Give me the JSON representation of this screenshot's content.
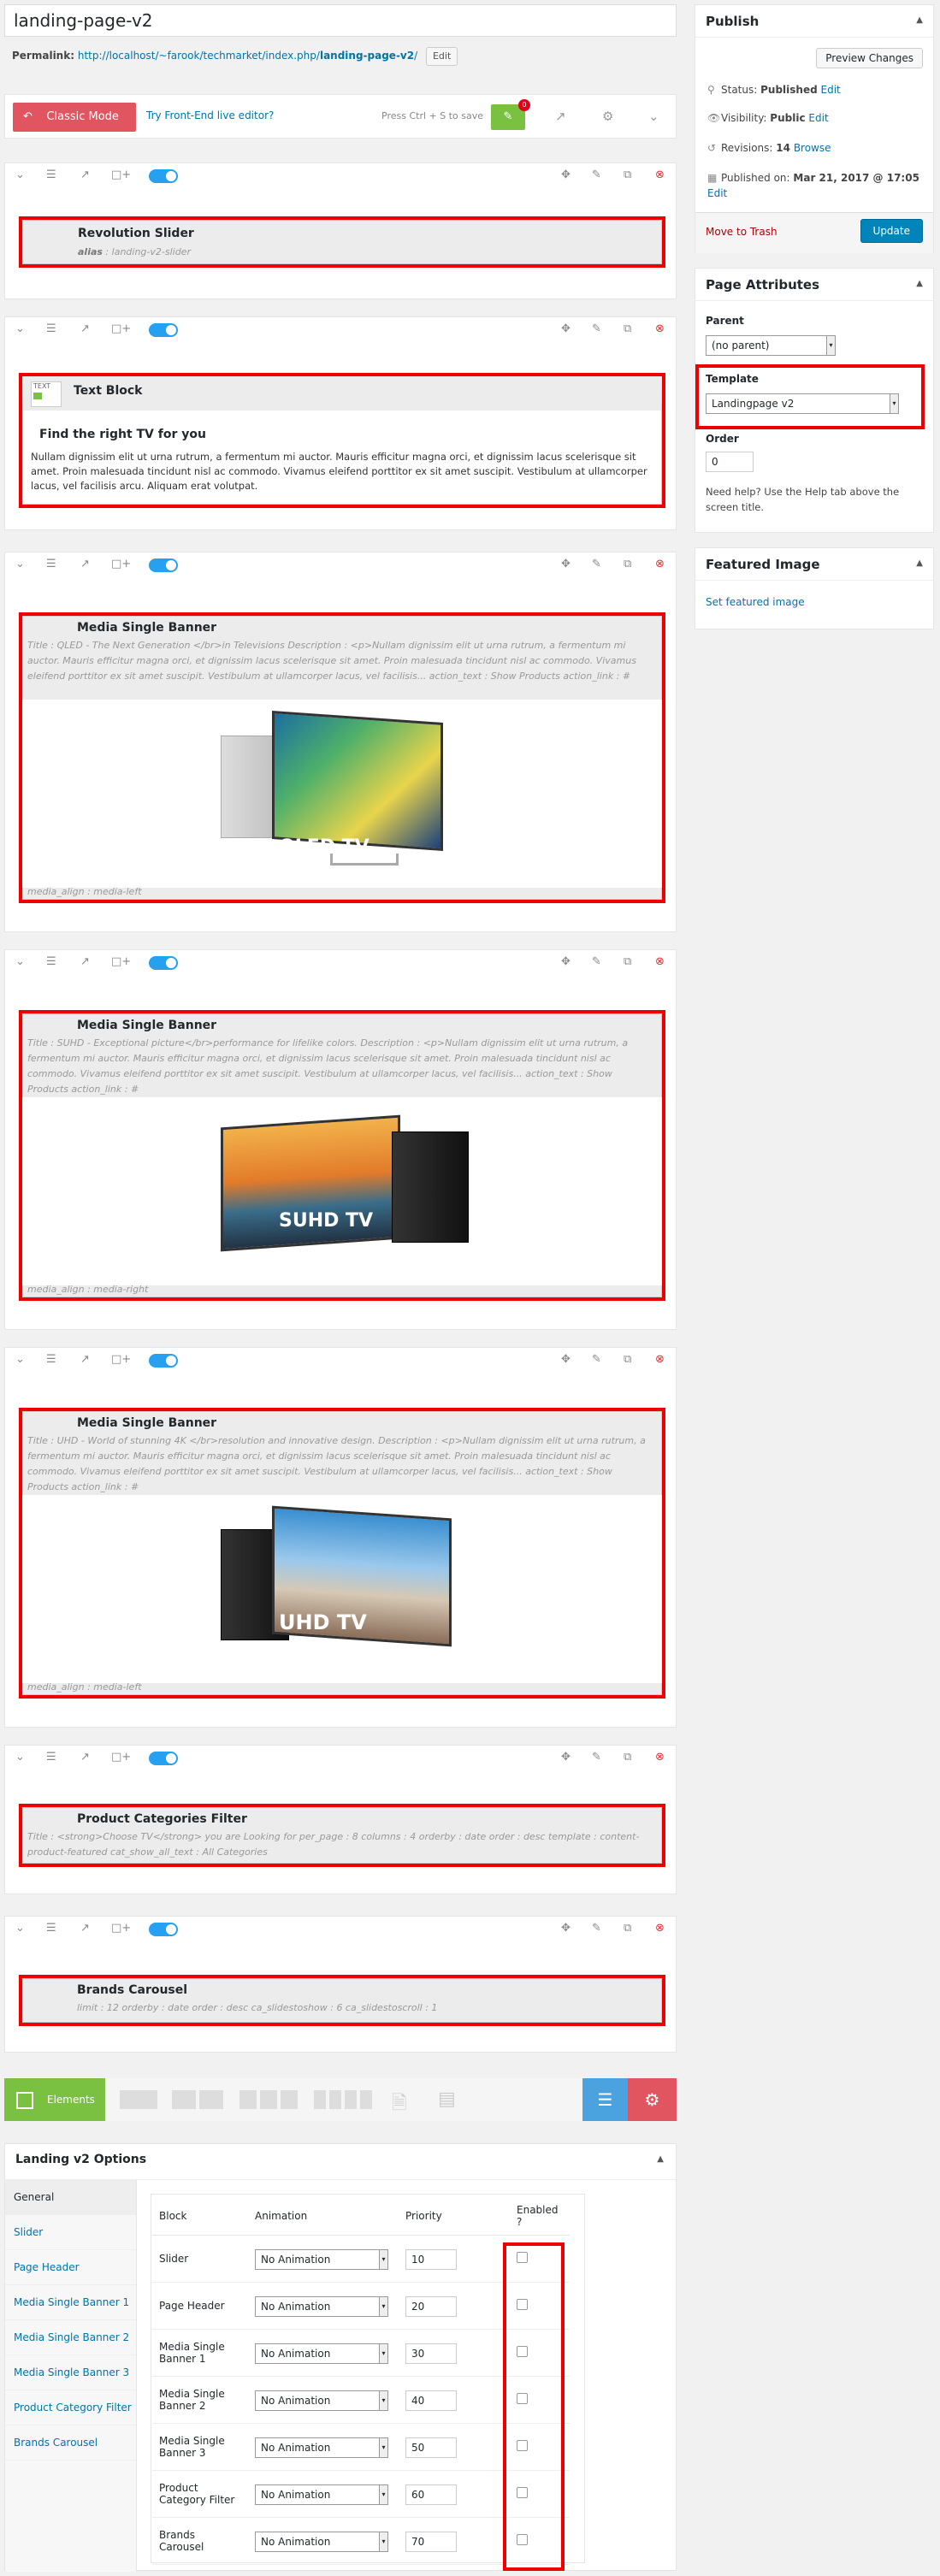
{
  "page_title": "landing-page-v2",
  "permalink": {
    "label": "Permalink:",
    "url_prefix": "http://localhost/~farook/techmarket/index.php/",
    "slug": "landing-page-v2",
    "url_suffix": "/",
    "edit": "Edit"
  },
  "vc_toolbar": {
    "classic_mode": "Classic Mode",
    "frontend_link": "Try Front-End live editor?",
    "save_hint": "Press Ctrl + S to save",
    "badge": "0"
  },
  "rows": [
    {
      "title": "Revolution Slider",
      "params": [
        {
          "k": "alias",
          "v": "landing-v2-slider"
        }
      ]
    },
    {
      "title": "Text Block",
      "heading": "Find the right TV for you",
      "text": "Nullam dignissim elit ut urna rutrum, a fermentum mi auctor. Mauris efficitur magna orci, et dignissim lacus scelerisque sit amet. Proin malesuada tincidunt nisl ac commodo. Vivamus eleifend porttitor ex sit amet suscipit. Vestibulum at ullamcorper lacus, vel facilisis arcu. Aliquam erat volutpat.",
      "icon_label": "TEXT"
    },
    {
      "title": "Media Single Banner",
      "desc": "Title : QLED - The Next Generation </br>in Televisions Description : <p>Nullam dignissim elit ut urna rutrum, a fermentum mi auctor. Mauris efficitur magna orci, et dignissim lacus scelerisque sit amet. Proin malesuada tincidunt nisl ac commodo. Vivamus eleifend porttitor ex sit amet suscipit. Vestibulum at ullamcorper lacus, vel facilisis... action_text : Show Products action_link : #",
      "align": "media_align : media-left",
      "tv_label": "QLED TV"
    },
    {
      "title": "Media Single Banner",
      "desc": "Title : SUHD - Exceptional picture</br>performance for lifelike colors. Description : <p>Nullam dignissim elit ut urna rutrum, a fermentum mi auctor. Mauris efficitur magna orci, et dignissim lacus scelerisque sit amet. Proin malesuada tincidunt nisl ac commodo. Vivamus eleifend porttitor ex sit amet suscipit. Vestibulum at ullamcorper lacus, vel facilisis... action_text : Show Products action_link : #",
      "align": "media_align : media-right",
      "tv_label": "SUHD TV"
    },
    {
      "title": "Media Single Banner",
      "desc": "Title : UHD - World of stunning 4K </br>resolution and innovative design. Description : <p>Nullam dignissim elit ut urna rutrum, a fermentum mi auctor. Mauris efficitur magna orci, et dignissim lacus scelerisque sit amet. Proin malesuada tincidunt nisl ac commodo. Vivamus eleifend porttitor ex sit amet suscipit. Vestibulum at ullamcorper lacus, vel facilisis... action_text : Show Products action_link : #",
      "align": "media_align : media-left",
      "tv_label": "UHD TV"
    },
    {
      "title": "Product Categories Filter",
      "desc": "Title : <strong>Choose TV</strong> you are Looking for per_page : 8 columns : 4 orderby : date order : desc template : content-product-featured cat_show_all_text : All Categories"
    },
    {
      "title": "Brands Carousel",
      "desc": "limit : 12 orderby : date order : desc ca_slidestoshow : 6 ca_slidestoscroll : 1"
    }
  ],
  "elements_tab": {
    "label": "Elements"
  },
  "publish": {
    "title": "Publish",
    "preview": "Preview Changes",
    "status_label": "Status:",
    "status_value": "Published",
    "status_edit": "Edit",
    "visibility_label": "Visibility:",
    "visibility_value": "Public",
    "visibility_edit": "Edit",
    "revisions_label": "Revisions:",
    "revisions_value": "14",
    "revisions_browse": "Browse",
    "published_label": "Published on:",
    "published_value": "Mar 21, 2017 @ 17:05",
    "published_edit": "Edit",
    "trash": "Move to Trash",
    "update": "Update"
  },
  "page_attributes": {
    "title": "Page Attributes",
    "parent_label": "Parent",
    "parent_value": "(no parent)",
    "template_label": "Template",
    "template_value": "Landingpage v2",
    "order_label": "Order",
    "order_value": "0",
    "help": "Need help? Use the Help tab above the screen title."
  },
  "featured_image": {
    "title": "Featured Image",
    "link": "Set featured image"
  },
  "options": {
    "title": "Landing v2 Options",
    "tabs": [
      "General",
      "Slider",
      "Page Header",
      "Media Single Banner 1",
      "Media Single Banner 2",
      "Media Single Banner 3",
      "Product Category Filter",
      "Brands Carousel"
    ],
    "columns": [
      "Block",
      "Animation",
      "Priority",
      "Enabled ?"
    ],
    "rows": [
      {
        "block": "Slider",
        "animation": "No Animation",
        "priority": "10"
      },
      {
        "block": "Page Header",
        "animation": "No Animation",
        "priority": "20"
      },
      {
        "block": "Media Single Banner 1",
        "animation": "No Animation",
        "priority": "30"
      },
      {
        "block": "Media Single Banner 2",
        "animation": "No Animation",
        "priority": "40"
      },
      {
        "block": "Media Single Banner 3",
        "animation": "No Animation",
        "priority": "50"
      },
      {
        "block": "Product Category Filter",
        "animation": "No Animation",
        "priority": "60"
      },
      {
        "block": "Brands Carousel",
        "animation": "No Animation",
        "priority": "70"
      }
    ]
  },
  "colors": {
    "accent": "#0073aa",
    "highlight": "#e00000",
    "toggle": "#26a0f0",
    "classic": "#e15561",
    "green": "#7ac142"
  }
}
